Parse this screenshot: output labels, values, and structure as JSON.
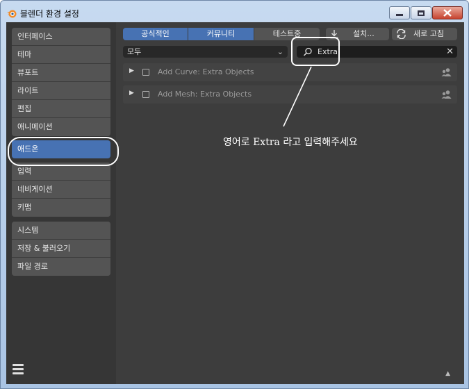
{
  "window": {
    "title": "블렌더 환경 설정",
    "icon": "blender-icon"
  },
  "sidebar": {
    "groups": [
      {
        "items": [
          {
            "label": "인터페이스"
          },
          {
            "label": "테마"
          },
          {
            "label": "뷰포트"
          },
          {
            "label": "라이트"
          },
          {
            "label": "편집"
          },
          {
            "label": "애니메이션"
          }
        ]
      },
      {
        "items": [
          {
            "label": "애드온",
            "active": true
          }
        ]
      },
      {
        "items": [
          {
            "label": "입력"
          },
          {
            "label": "네비게이션"
          },
          {
            "label": "키맵"
          }
        ]
      },
      {
        "items": [
          {
            "label": "시스템"
          },
          {
            "label": "저장 & 불러오기"
          },
          {
            "label": "파일 경로"
          }
        ]
      }
    ]
  },
  "toolbar": {
    "support_tabs": [
      {
        "label": "공식적인",
        "selected": true
      },
      {
        "label": "커뮤니티",
        "selected": true
      },
      {
        "label": "테스트중",
        "selected": false
      }
    ],
    "install_label": "설치...",
    "refresh_label": "새로 고침"
  },
  "filter": {
    "category": "모두",
    "search_value": "Extra"
  },
  "addons": [
    {
      "name": "Add Curve: Extra Objects"
    },
    {
      "name": "Add Mesh: Extra Objects"
    }
  ],
  "annotation": {
    "text": "영어로 Extra 라고 입력해주세요"
  },
  "colors": {
    "accent": "#4772b3",
    "background": "#3d3d3d",
    "sidebar": "#363636",
    "button": "#545454"
  }
}
